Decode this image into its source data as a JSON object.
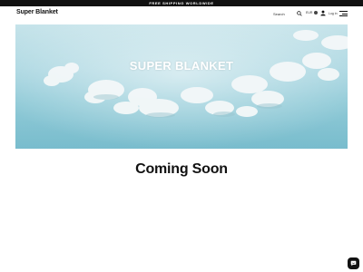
{
  "announcement": {
    "text": "FREE SHIPPING WORLDWIDE"
  },
  "header": {
    "logo": "Super Blanket",
    "search_placeholder": "Search",
    "currency": "EUR",
    "login": "Log in"
  },
  "hero": {
    "title": "SUPER BLANKET"
  },
  "main": {
    "heading": "Coming Soon"
  },
  "icons": {
    "search": "search-icon",
    "account": "account-icon",
    "menu": "menu-icon",
    "chat": "chat-icon"
  }
}
